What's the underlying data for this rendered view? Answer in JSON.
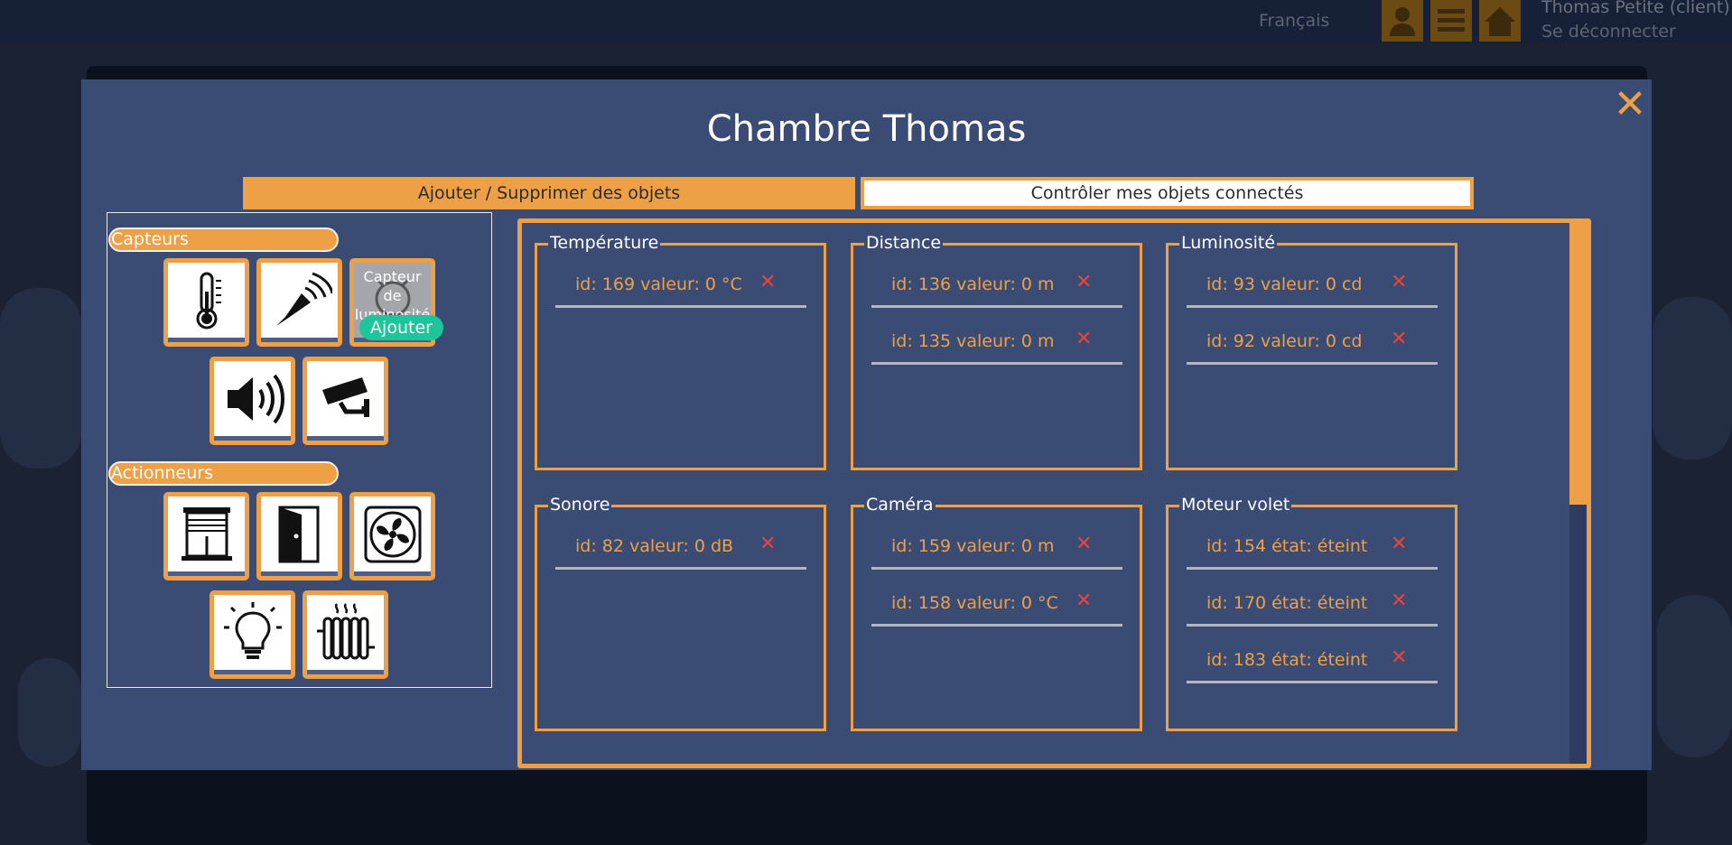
{
  "header": {
    "language": "Français",
    "user_name": "Thomas Petite (client)",
    "logout": "Se déconnecter",
    "icons": [
      "user-icon",
      "list-icon",
      "home-icon"
    ]
  },
  "modal": {
    "title": "Chambre Thomas",
    "close_icon": "close-icon",
    "tabs": {
      "add_remove": "Ajouter / Supprimer des objets",
      "control": "Contrôler mes objets connectés"
    },
    "palette": {
      "sensors_label": "Capteurs",
      "actuators_label": "Actionneurs",
      "sensors": [
        "thermometer-icon",
        "ultrasound-icon",
        "light-sensor-icon",
        "speaker-icon",
        "camera-icon"
      ],
      "actuators": [
        "shutter-icon",
        "door-icon",
        "fan-icon",
        "bulb-icon",
        "radiator-icon"
      ],
      "hover_tile_label": "Capteur de luminosité",
      "add_button": "Ajouter"
    },
    "groups": [
      {
        "title": "Température",
        "items": [
          "id: 169 valeur: 0 °C"
        ]
      },
      {
        "title": "Distance",
        "items": [
          "id: 136 valeur: 0 m",
          "id: 135 valeur: 0 m"
        ]
      },
      {
        "title": "Luminosité",
        "items": [
          "id: 93 valeur: 0 cd",
          "id: 92 valeur: 0 cd"
        ]
      },
      {
        "title": "Sonore",
        "items": [
          "id: 82 valeur: 0 dB"
        ]
      },
      {
        "title": "Caméra",
        "items": [
          "id: 159 valeur: 0 m",
          "id: 158 valeur: 0 °C"
        ]
      },
      {
        "title": "Moteur volet",
        "items": [
          "id: 154 état: éteint",
          "id: 170 état: éteint",
          "id: 183 état: éteint"
        ]
      }
    ],
    "delete_symbol": "✕",
    "colors": {
      "accent": "#eea047",
      "modal_bg": "#3a4b74",
      "delete": "#e8453c",
      "add_button": "#1cc59a"
    }
  }
}
